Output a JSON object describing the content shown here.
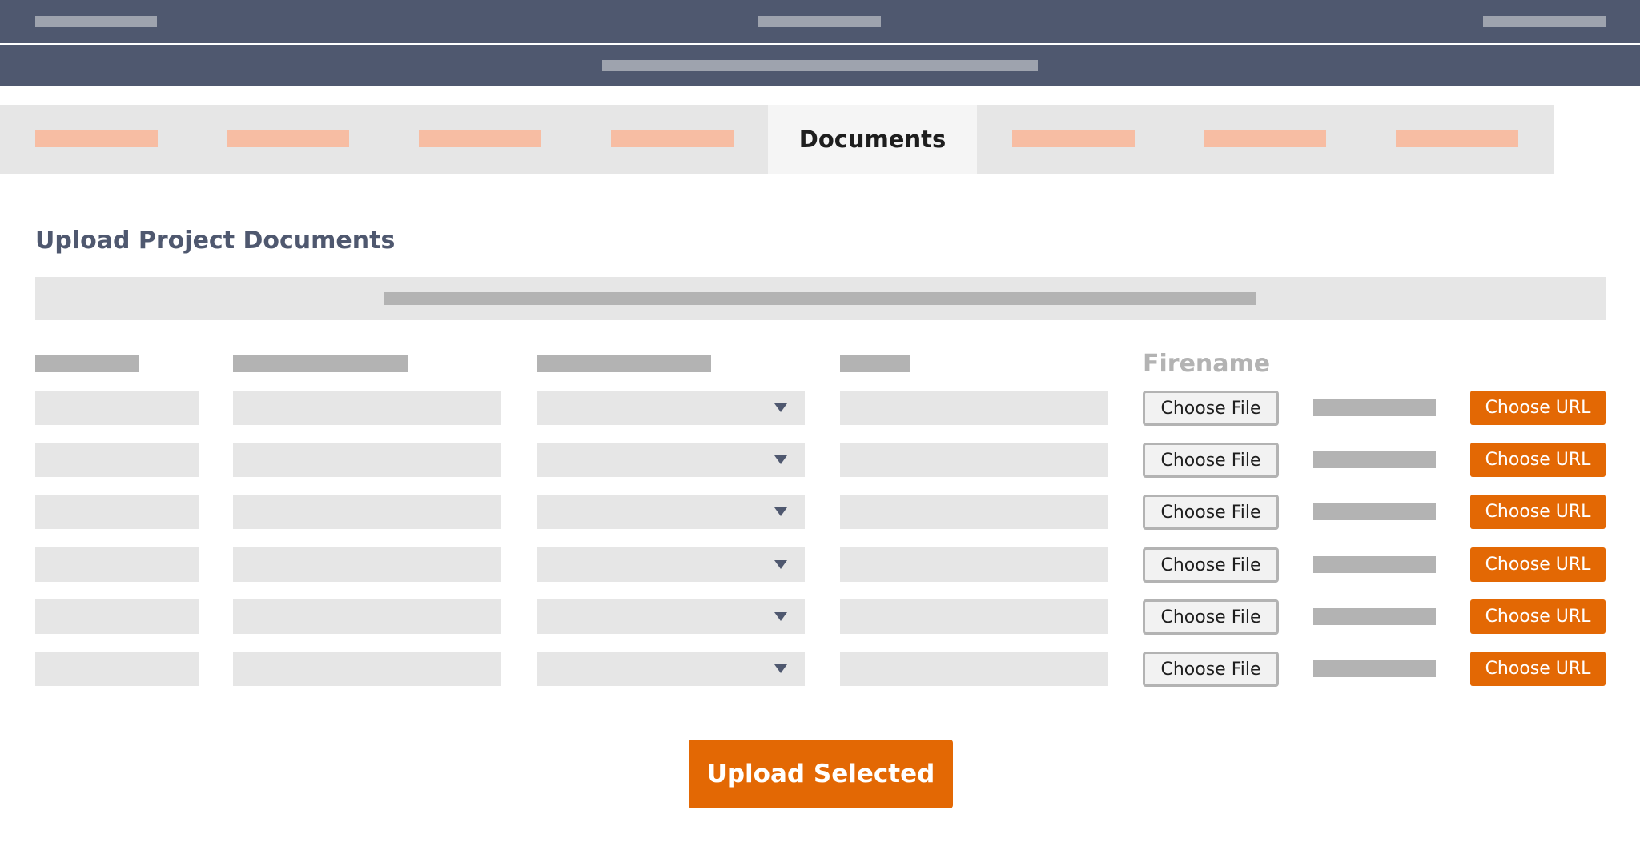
{
  "tabs": {
    "active_label": "Documents"
  },
  "section": {
    "title": "Upload Project Documents"
  },
  "table": {
    "filename_header": "Firename",
    "rows": [
      {
        "choose_file_label": "Choose File",
        "choose_url_label": "Choose URL"
      },
      {
        "choose_file_label": "Choose File",
        "choose_url_label": "Choose URL"
      },
      {
        "choose_file_label": "Choose File",
        "choose_url_label": "Choose URL"
      },
      {
        "choose_file_label": "Choose File",
        "choose_url_label": "Choose URL"
      },
      {
        "choose_file_label": "Choose File",
        "choose_url_label": "Choose URL"
      },
      {
        "choose_file_label": "Choose File",
        "choose_url_label": "Choose URL"
      }
    ]
  },
  "actions": {
    "upload_label": "Upload Selected"
  },
  "colors": {
    "header_bg": "#4f586f",
    "accent": "#e36804",
    "tab_placeholder": "#f7bda3",
    "field_bg": "#e6e6e6"
  },
  "icons": {
    "select_arrow": "caret-down-icon"
  }
}
